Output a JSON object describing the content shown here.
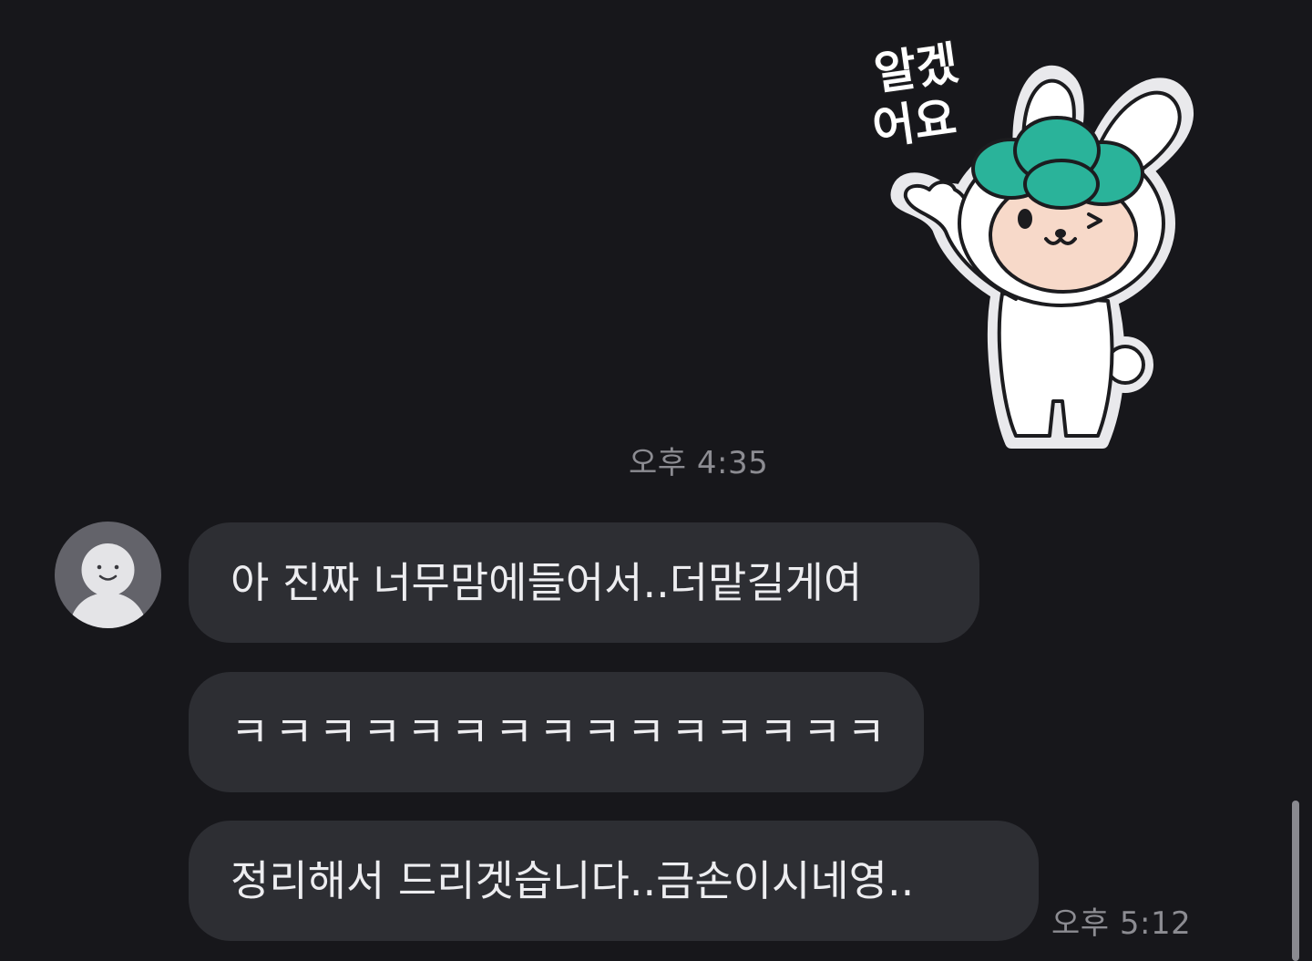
{
  "chat": {
    "messages": {
      "sticker": {
        "text": "알겠어요",
        "time": "오후 4:35"
      },
      "received": {
        "bubbles": [
          "아 진짜 너무맘에들어서..더맡길게여",
          "ㅋㅋㅋㅋㅋㅋㅋㅋㅋㅋㅋㅋㅋㅋㅋ",
          "정리해서 드리겟습니다..금손이시네영.."
        ],
        "time": "오후 5:12"
      }
    }
  },
  "icons": {
    "avatar": "default-profile-icon"
  },
  "colors": {
    "background": "#17171b",
    "bubble": "#2d2e33",
    "bubble_text": "#ededf0",
    "timestamp": "#8c8c92",
    "sticker_accent": "#2ab39a"
  }
}
